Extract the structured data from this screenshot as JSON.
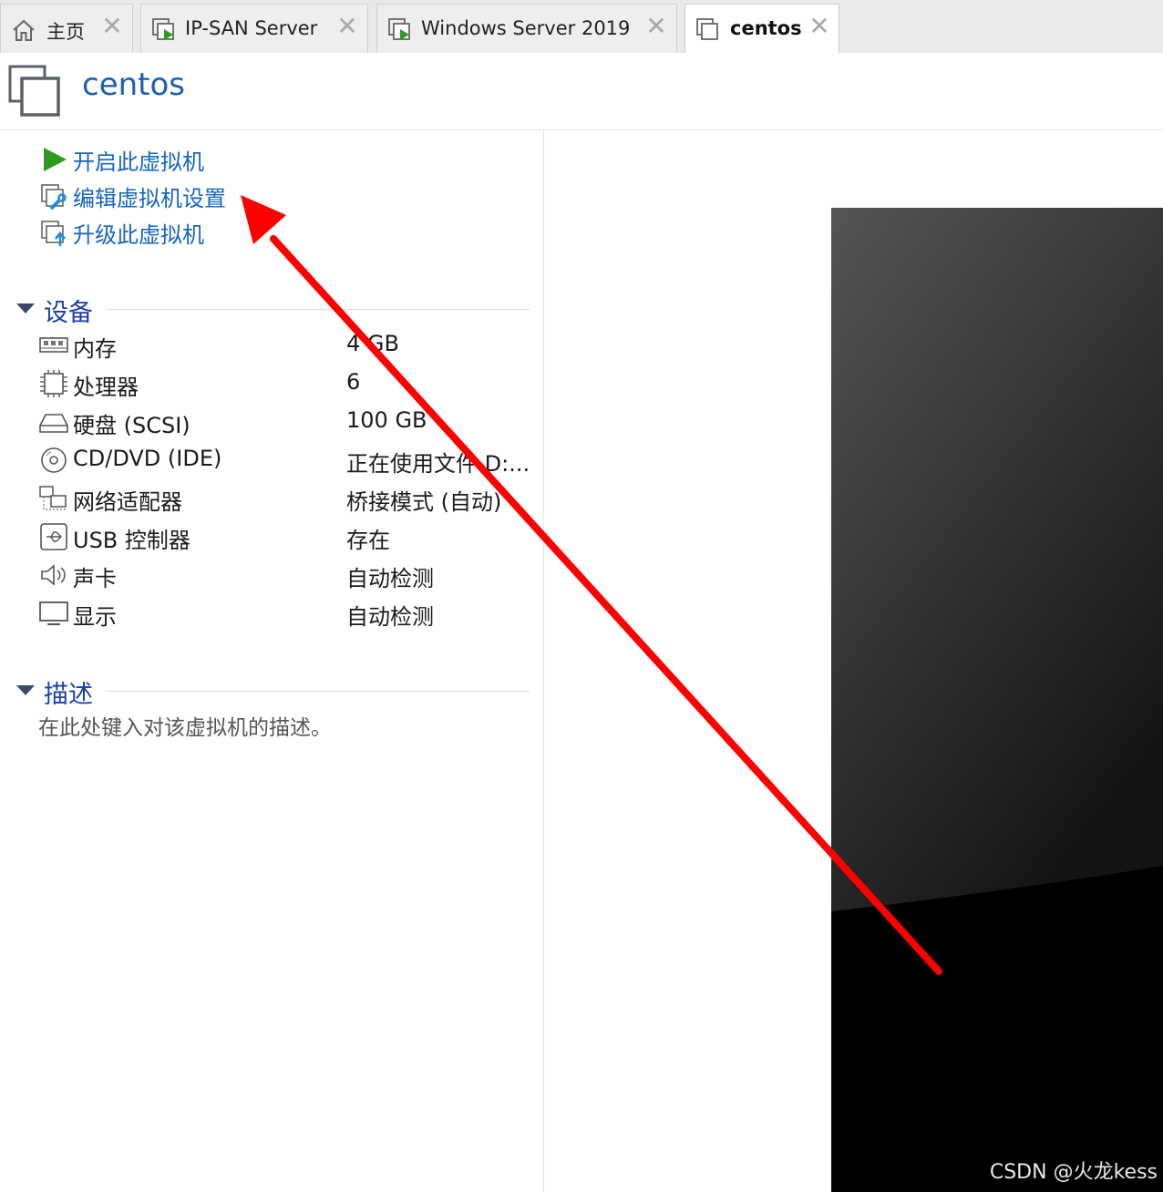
{
  "tabs": [
    {
      "label": "主页",
      "icon": "home-icon"
    },
    {
      "label": "IP-SAN Server",
      "icon": "vm-running-icon"
    },
    {
      "label": "Windows Server 2019",
      "icon": "vm-running-icon"
    },
    {
      "label": "centos",
      "icon": "vm-icon",
      "active": true
    }
  ],
  "tab_close_glyph": "✕",
  "header": {
    "title": "centos"
  },
  "actions": [
    {
      "label": "开启此虚拟机",
      "icon": "play-icon"
    },
    {
      "label": "编辑虚拟机设置",
      "icon": "edit-settings-icon"
    },
    {
      "label": "升级此虚拟机",
      "icon": "upgrade-icon"
    }
  ],
  "devices_section": {
    "title": "设备",
    "items": [
      {
        "name": "内存",
        "value": "4 GB",
        "icon": "memory-icon"
      },
      {
        "name": "处理器",
        "value": "6",
        "icon": "processor-icon"
      },
      {
        "name": "硬盘 (SCSI)",
        "value": "100 GB",
        "icon": "hard-disk-icon"
      },
      {
        "name": "CD/DVD (IDE)",
        "value": "正在使用文件 D:...",
        "icon": "cd-dvd-icon"
      },
      {
        "name": "网络适配器",
        "value": "桥接模式 (自动)",
        "icon": "network-adapter-icon"
      },
      {
        "name": "USB 控制器",
        "value": "存在",
        "icon": "usb-icon"
      },
      {
        "name": "声卡",
        "value": "自动检测",
        "icon": "sound-card-icon"
      },
      {
        "name": "显示",
        "value": "自动检测",
        "icon": "display-icon"
      }
    ]
  },
  "description_section": {
    "title": "描述",
    "placeholder": "在此处键入对该虚拟机的描述。"
  },
  "watermark": "CSDN @火龙kess",
  "colors": {
    "accent": "#1565c0",
    "annotation_arrow": "#ff0000",
    "play": "#2e9b1f"
  }
}
